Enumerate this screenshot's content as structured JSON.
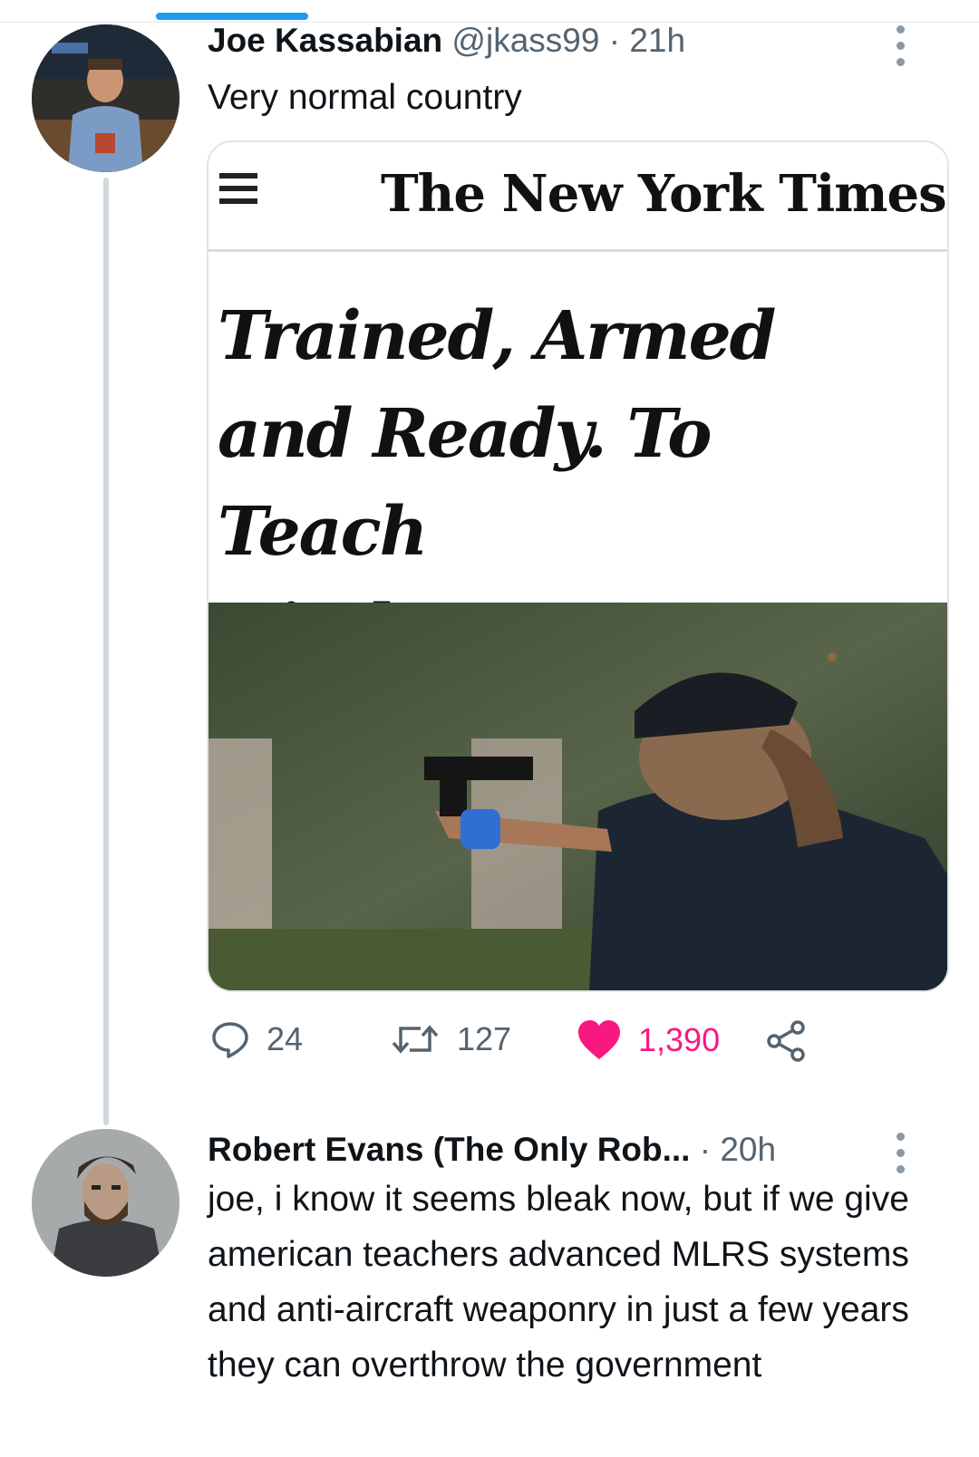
{
  "tweet1": {
    "author_name": "Joe Kassabian",
    "handle": "@jkass99",
    "time": "21h",
    "text": "Very normal country",
    "card": {
      "masthead": "The New York Times",
      "headline": "Trained, Armed and Ready. To Teach Kindergarten."
    },
    "actions": {
      "replies": "24",
      "retweets": "127",
      "likes": "1,390"
    }
  },
  "tweet2": {
    "author_name": "Robert Evans (The Only Rob...",
    "time": "20h",
    "text": "joe, i know it seems bleak now, but if we give american teachers advanced MLRS systems and anti-aircraft weaponry in just a few years they can overthrow the government"
  },
  "icons": {
    "reply": "reply-icon",
    "retweet": "retweet-icon",
    "like": "heart-icon",
    "share": "share-icon",
    "more": "more-vertical-icon",
    "menu": "hamburger-menu-icon"
  },
  "colors": {
    "accent_blue": "#1d9bf0",
    "like_pink": "#f91880",
    "meta_gray": "#536471"
  }
}
